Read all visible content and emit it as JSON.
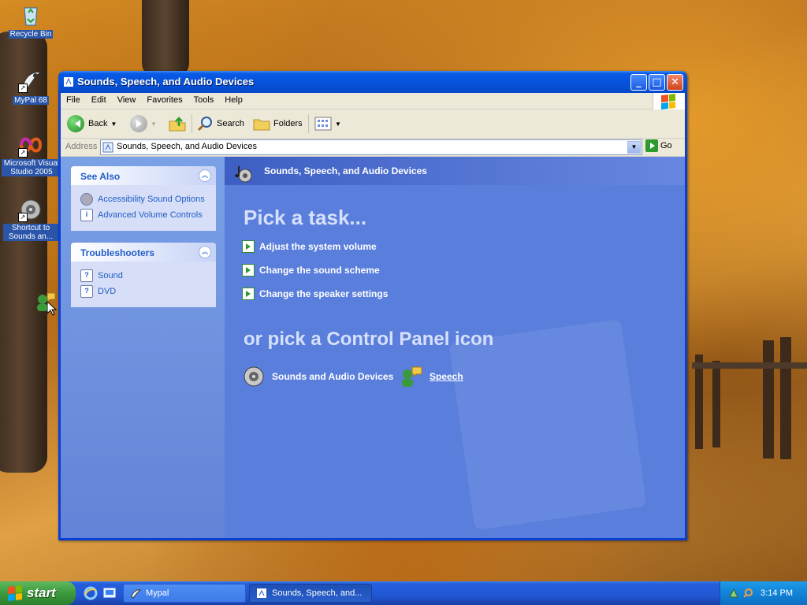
{
  "desktop": {
    "icons": [
      {
        "label": "Recycle Bin"
      },
      {
        "label": "MyPal 68"
      },
      {
        "label": "Microsoft Visual Studio 2005"
      },
      {
        "label": "Shortcut to Sounds an..."
      }
    ]
  },
  "window": {
    "title": "Sounds, Speech, and Audio Devices",
    "menu": [
      "File",
      "Edit",
      "View",
      "Favorites",
      "Tools",
      "Help"
    ],
    "toolbar": {
      "back": "Back",
      "search": "Search",
      "folders": "Folders"
    },
    "address": {
      "label": "Address",
      "value": "Sounds, Speech, and Audio Devices",
      "go": "Go"
    }
  },
  "left_pane": {
    "see_also": {
      "title": "See Also",
      "items": [
        "Accessibility Sound Options",
        "Advanced Volume Controls"
      ]
    },
    "troubleshooters": {
      "title": "Troubleshooters",
      "items": [
        "Sound",
        "DVD"
      ]
    }
  },
  "main": {
    "header": "Sounds, Speech, and Audio Devices",
    "pick_task": "Pick a task...",
    "tasks": [
      "Adjust the system volume",
      "Change the sound scheme",
      "Change the speaker settings"
    ],
    "or_pick": "or pick a Control Panel icon",
    "icons": [
      "Sounds and Audio Devices",
      "Speech"
    ]
  },
  "taskbar": {
    "start": "start",
    "items": [
      "Mypal",
      "Sounds, Speech, and..."
    ],
    "clock": "3:14 PM"
  }
}
